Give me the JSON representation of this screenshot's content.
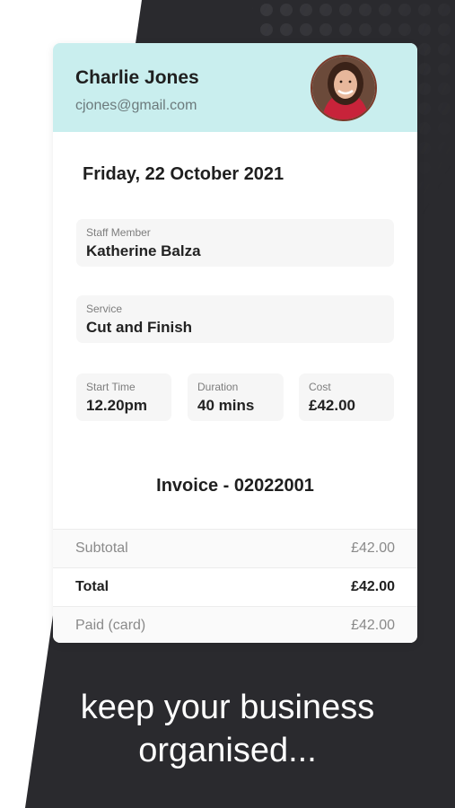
{
  "customer": {
    "name": "Charlie Jones",
    "email": "cjones@gmail.com"
  },
  "appointment": {
    "date": "Friday, 22 October 2021",
    "staff": {
      "label": "Staff Member",
      "value": "Katherine Balza"
    },
    "service": {
      "label": "Service",
      "value": "Cut and Finish"
    },
    "start": {
      "label": "Start Time",
      "value": "12.20pm"
    },
    "duration": {
      "label": "Duration",
      "value": "40 mins"
    },
    "cost": {
      "label": "Cost",
      "value": "£42.00"
    }
  },
  "invoice": {
    "title": "Invoice - 02022001",
    "rows": [
      {
        "label": "Subtotal",
        "value": "£42.00"
      },
      {
        "label": "Total",
        "value": "£42.00"
      },
      {
        "label": "Paid (card)",
        "value": "£42.00"
      }
    ]
  },
  "tagline": {
    "line1": "keep your business",
    "line2": "organised..."
  },
  "colors": {
    "header_bg": "#c9eeee",
    "dark_bg": "#2a2a2e",
    "dots": "#46464b"
  }
}
